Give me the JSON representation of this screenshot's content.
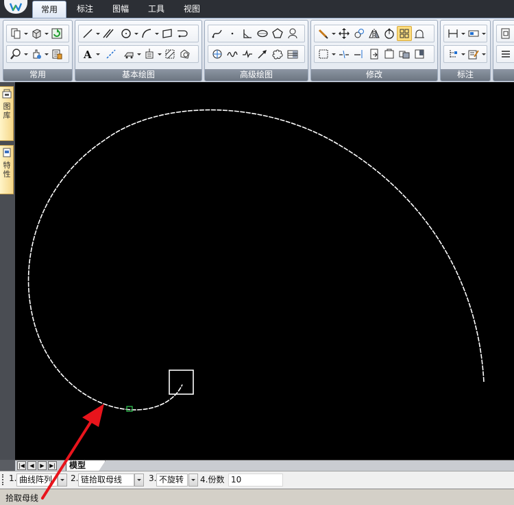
{
  "app": {
    "logo_icon": "app-logo-icon"
  },
  "tabs": [
    {
      "label": "常用",
      "active": true
    },
    {
      "label": "标注",
      "active": false
    },
    {
      "label": "图幅",
      "active": false
    },
    {
      "label": "工具",
      "active": false
    },
    {
      "label": "视图",
      "active": false
    }
  ],
  "ribbon": {
    "groups": [
      {
        "label": "常用",
        "row1": [
          "copy-pages-icon",
          "3d-box-icon",
          "refresh-green-icon"
        ],
        "row2": [
          "zoom-icon",
          "hand-settings-icon",
          "properties-icon"
        ]
      },
      {
        "label": "基本绘图",
        "row1": [
          "line-icon",
          "parallel-lines-icon",
          "circle-icon",
          "arc-icon",
          "rectangle-icon",
          "polyline-loop-icon"
        ],
        "row2": [
          "text-a-icon",
          "dashed-line-icon",
          "fill-pattern-icon",
          "insert-block-icon",
          "hatch-icon",
          "region-icon"
        ]
      },
      {
        "label": "高级绘图",
        "row1": [
          "spline-icon",
          "point-icon",
          "angle-icon",
          "ellipse-icon",
          "polygon-icon",
          "gear-icon"
        ],
        "row2": [
          "curve-array-icon",
          "wave-icon",
          "break-line-icon",
          "arrow-icon",
          "cloud-icon",
          "table-icon"
        ]
      },
      {
        "label": "修改",
        "row1": [
          "erase-icon",
          "move-icon",
          "rotate-icon",
          "mirror-icon",
          "offset-icon",
          "array-icon",
          "stretch-icon"
        ],
        "row2": [
          "select-window-icon",
          "trim-icon",
          "extend-icon",
          "export-icon",
          "copy-icon",
          "break-icon",
          "explode-icon"
        ]
      },
      {
        "label": "标注",
        "row1": [
          "dimension-icon",
          "dim-style-icon"
        ],
        "row2": [
          "dim-tree-icon",
          "edit-dim-icon"
        ]
      },
      {
        "label": "",
        "row1": [
          "more-icon"
        ],
        "row2": [
          "menu-icon"
        ]
      }
    ]
  },
  "side_panel": {
    "tabs": [
      {
        "label": "图库",
        "icon": "library-icon"
      },
      {
        "label": "特性",
        "icon": "properties-panel-icon"
      }
    ]
  },
  "model_tabs": {
    "nav": [
      "first-icon",
      "prev-icon",
      "next-icon",
      "last-icon"
    ],
    "active": "模型"
  },
  "command_options": {
    "opt1": {
      "number": "1.",
      "value": "曲线阵列"
    },
    "opt2": {
      "number": "2.",
      "value": "链拾取母线"
    },
    "opt3": {
      "number": "3.",
      "value": "不旋转"
    },
    "opt4": {
      "number": "4.份数",
      "value": "10"
    }
  },
  "status": {
    "prompt": "拾取母线"
  },
  "colors": {
    "curve": "#ffffff",
    "pick_box": "#ffffff",
    "snap_marker": "#2fbf4f",
    "annotation_arrow": "#e8141c"
  }
}
